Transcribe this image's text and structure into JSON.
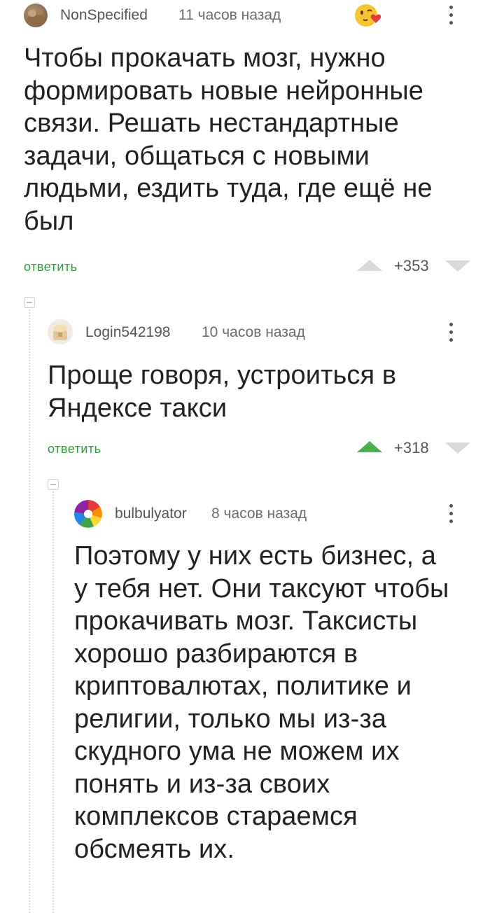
{
  "comments": [
    {
      "username": "NonSpecified",
      "time": "11 часов назад",
      "text": "Чтобы прокачать мозг, нужно формировать новые нейронные связи. Решать нестандартные задачи, общаться с новыми людьми, ездить туда, где ещё не был",
      "reply_label": "ответить",
      "rating": "+353",
      "upvoted": false
    },
    {
      "username": "Login542198",
      "time": "10 часов назад",
      "text": "Проще говоря, устроиться в Яндексе такси",
      "reply_label": "ответить",
      "rating": "+318",
      "upvoted": true
    },
    {
      "username": "bulbulyator",
      "time": "8 часов назад",
      "text": "Поэтому у них есть бизнес, а у тебя нет. Они таксуют чтобы прокачивать мозг. Таксисты хорошо разбираются в криптовалютах, политике и религии, только мы из-за скудного ума не можем их понять и из-за своих комплексов стараемся обсмеять их."
    }
  ],
  "colors": {
    "upvote_active": "#4caf50",
    "vote_inactive": "#d9d9d9",
    "reply": "#2f9e37"
  },
  "icons": {
    "emoji_badge": "heart-kiss-emoji-icon",
    "more": "kebab-icon",
    "collapse": "minus-box-icon"
  }
}
